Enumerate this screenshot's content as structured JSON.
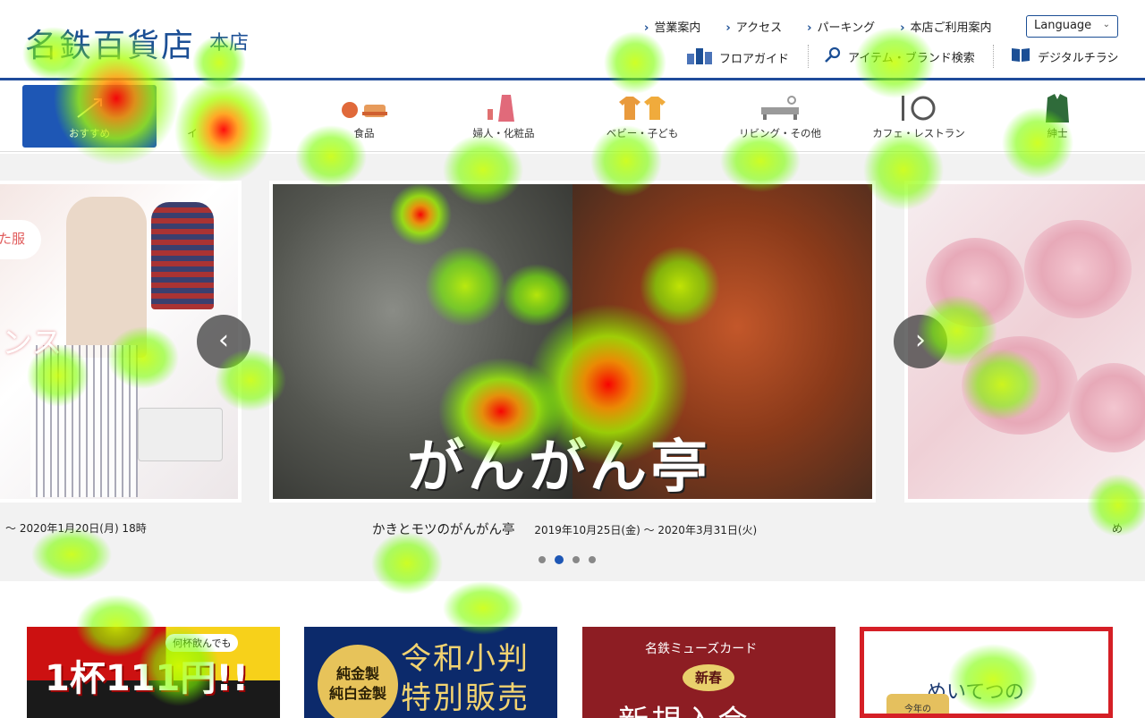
{
  "header": {
    "logo": "名鉄百貨店",
    "store": "本店",
    "links": [
      "営業案内",
      "アクセス",
      "パーキング",
      "本店ご利用案内"
    ],
    "language": "Language",
    "tools": {
      "floor": "フロアガイド",
      "search": "アイテム・ブランド検索",
      "flyer": "デジタルチラシ"
    }
  },
  "nav": {
    "categories": [
      {
        "label": "おすすめ",
        "icon": "recommend-icon"
      },
      {
        "label": "イ",
        "icon": "event-icon"
      },
      {
        "label": "食品",
        "icon": "food-icon"
      },
      {
        "label": "婦人・化粧品",
        "icon": "women-cosmetics-icon"
      },
      {
        "label": "ベビー・子ども",
        "icon": "baby-kids-icon"
      },
      {
        "label": "リビング・その他",
        "icon": "living-icon"
      },
      {
        "label": "カフェ・レストラン",
        "icon": "cafe-restaurant-icon"
      },
      {
        "label": "紳士",
        "icon": "menswear-icon"
      }
    ]
  },
  "slider": {
    "left": {
      "badge": "た服",
      "big": "ンス",
      "caption": "〜 2020年1月20日(月) 18時"
    },
    "center": {
      "overlay": "がんがん亭",
      "title": "かきとモツのがんがん亭",
      "dates": "2019年10月25日(金) 〜 2020年3月31日(火)"
    },
    "right": {
      "caption": "め"
    },
    "dots_active": 1,
    "dots_count": 4
  },
  "banners": {
    "b1": {
      "text": "1杯111円!!",
      "note": "何杯飲んでも"
    },
    "b2": {
      "circle1": "純金製",
      "circle2": "純白金製",
      "line1": "令和小判",
      "line2": "特別販売"
    },
    "b3": {
      "title": "名鉄ミューズカード",
      "badge": "新春",
      "big": "新規入会"
    },
    "b4": {
      "big": "めいてつの",
      "tag": "今年の"
    }
  }
}
